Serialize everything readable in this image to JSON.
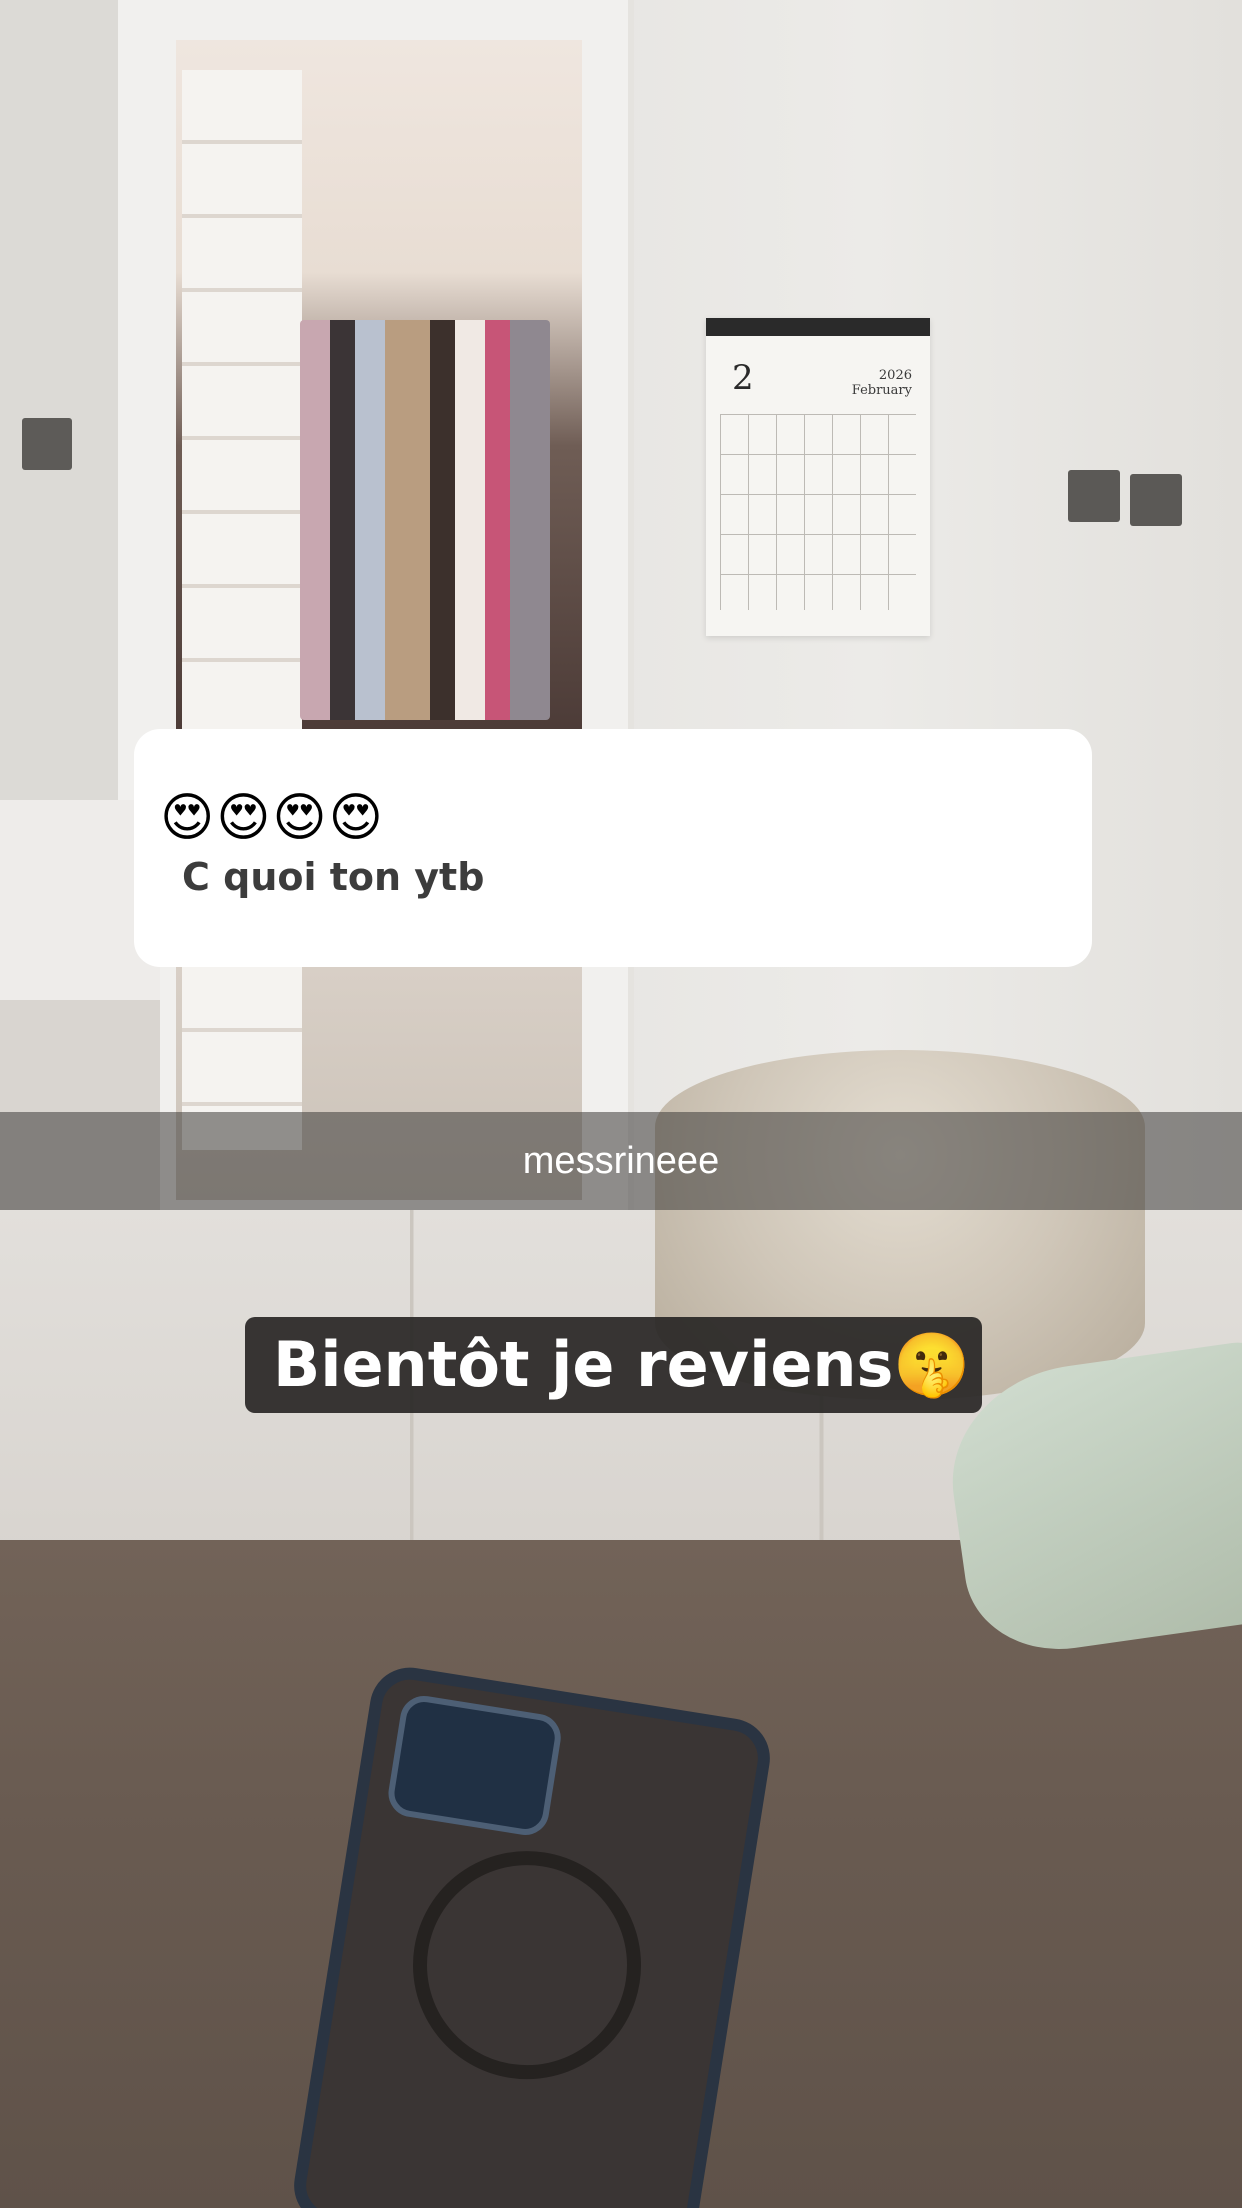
{
  "question_box": {
    "emojis": "😍😍😍😍",
    "text": "C quoi ton ytb"
  },
  "username": "messrineee",
  "caption": "Bientôt je reviens🤫",
  "calendar": {
    "day_number": "2",
    "year": "2026",
    "month": "February"
  }
}
